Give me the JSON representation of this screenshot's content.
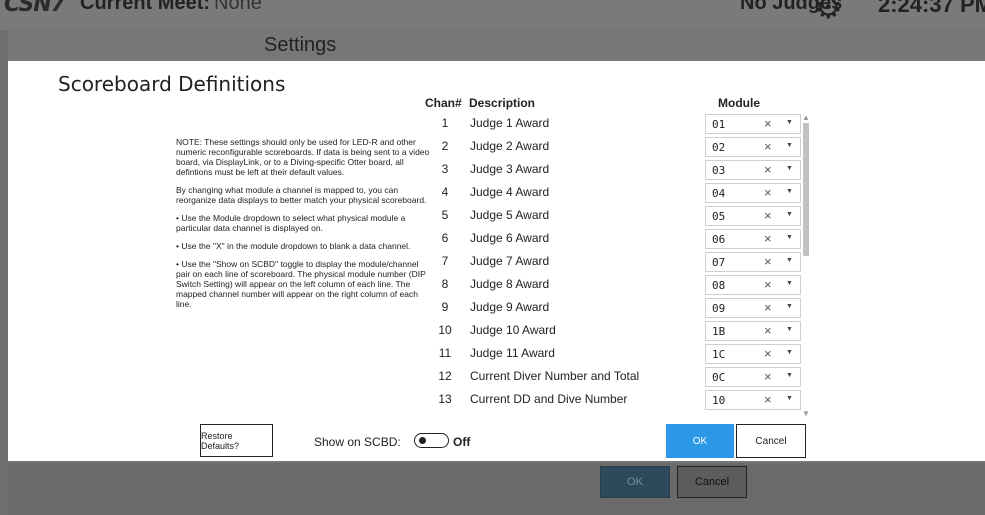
{
  "app": {
    "logo_text": "CSN7",
    "current_meet_label": "Current Meet:",
    "current_meet_value": "None",
    "judges_status": "No Judges",
    "clock": "2:24:37 PM"
  },
  "background_window": {
    "title": "Settings",
    "ok_label": "OK",
    "cancel_label": "Cancel"
  },
  "dialog": {
    "title": "Scoreboard Definitions",
    "note": [
      "NOTE: These settings should only be used for LED-R and other numeric reconfigurable scoreboards. If data is being sent to a video board, via DisplayLink, or to a Diving-specific Otter board, all defintions must be left at their default values.",
      "By changing what module a channel is mapped to, you can reorganize data displays to better match your physical scoreboard.",
      "• Use the Module dropdown to select what physical module a particular data channel is displayed on.",
      "• Use the \"X\" in the module dropdown to blank a data channel.",
      "• Use the \"Show on SCBD\" toggle to display the module/channel pair on each line of scoreboard. The physical module number (DIP Switch Setting) will appear on the left column of each line. The mapped channel number will appear on the right column of each line."
    ],
    "columns": {
      "chan": "Chan#",
      "description": "Description",
      "module": "Module"
    },
    "rows": [
      {
        "chan": "1",
        "description": "Judge 1 Award",
        "module": "01"
      },
      {
        "chan": "2",
        "description": "Judge 2 Award",
        "module": "02"
      },
      {
        "chan": "3",
        "description": "Judge 3 Award",
        "module": "03"
      },
      {
        "chan": "4",
        "description": "Judge 4 Award",
        "module": "04"
      },
      {
        "chan": "5",
        "description": "Judge 5 Award",
        "module": "05"
      },
      {
        "chan": "6",
        "description": "Judge 6 Award",
        "module": "06"
      },
      {
        "chan": "7",
        "description": "Judge 7 Award",
        "module": "07"
      },
      {
        "chan": "8",
        "description": "Judge 8 Award",
        "module": "08"
      },
      {
        "chan": "9",
        "description": "Judge 9 Award",
        "module": "09"
      },
      {
        "chan": "10",
        "description": "Judge 10 Award",
        "module": "1B"
      },
      {
        "chan": "11",
        "description": "Judge 11 Award",
        "module": "1C"
      },
      {
        "chan": "12",
        "description": "Current Diver Number and Total",
        "module": "0C"
      },
      {
        "chan": "13",
        "description": "Current DD and Dive Number",
        "module": "10"
      }
    ],
    "clear_glyph": "×",
    "dropdown_glyph": "▼",
    "restore_label": "Restore Defaults?",
    "show_on_scbd_label": "Show on SCBD:",
    "toggle_state_label": "Off",
    "ok_label": "OK",
    "cancel_label": "Cancel"
  },
  "colors": {
    "accent": "#2c98e8",
    "overlay": "#777777"
  }
}
